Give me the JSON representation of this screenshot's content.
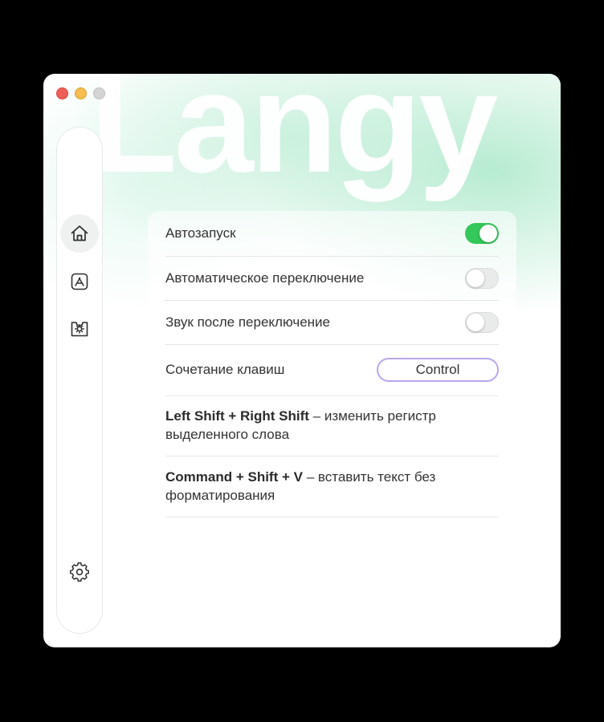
{
  "app": {
    "brand_text": "Langy"
  },
  "window_controls": [
    "close",
    "minimize",
    "maximize"
  ],
  "sidebar": {
    "items": [
      {
        "name": "home",
        "icon": "home-icon",
        "active": true
      },
      {
        "name": "app-store",
        "icon": "app-store-icon",
        "active": false
      },
      {
        "name": "plugin",
        "icon": "plugin-icon",
        "active": false
      }
    ],
    "footer_icon": "gear-icon"
  },
  "settings": {
    "autostart": {
      "label": "Автозапуск",
      "enabled": true
    },
    "auto_switch": {
      "label": "Автоматическое переключение",
      "enabled": false
    },
    "sound_after_switch": {
      "label": "Звук после переключение",
      "enabled": false
    },
    "hotkey": {
      "label": "Сочетание клавиш",
      "value": "Control"
    }
  },
  "shortcuts": [
    {
      "keys": "Left Shift + Right Shift",
      "separator": " – ",
      "description": "изменить регистр выделенного слова"
    },
    {
      "keys": "Command + Shift + V",
      "separator": " – ",
      "description": "вставить текст без форматирования"
    }
  ],
  "colors": {
    "toggle_on": "#34c759",
    "toggle_off": "#e9eaea",
    "hotkey_border": "#b9a6ea",
    "accent_gradient": "#aae8c8"
  }
}
